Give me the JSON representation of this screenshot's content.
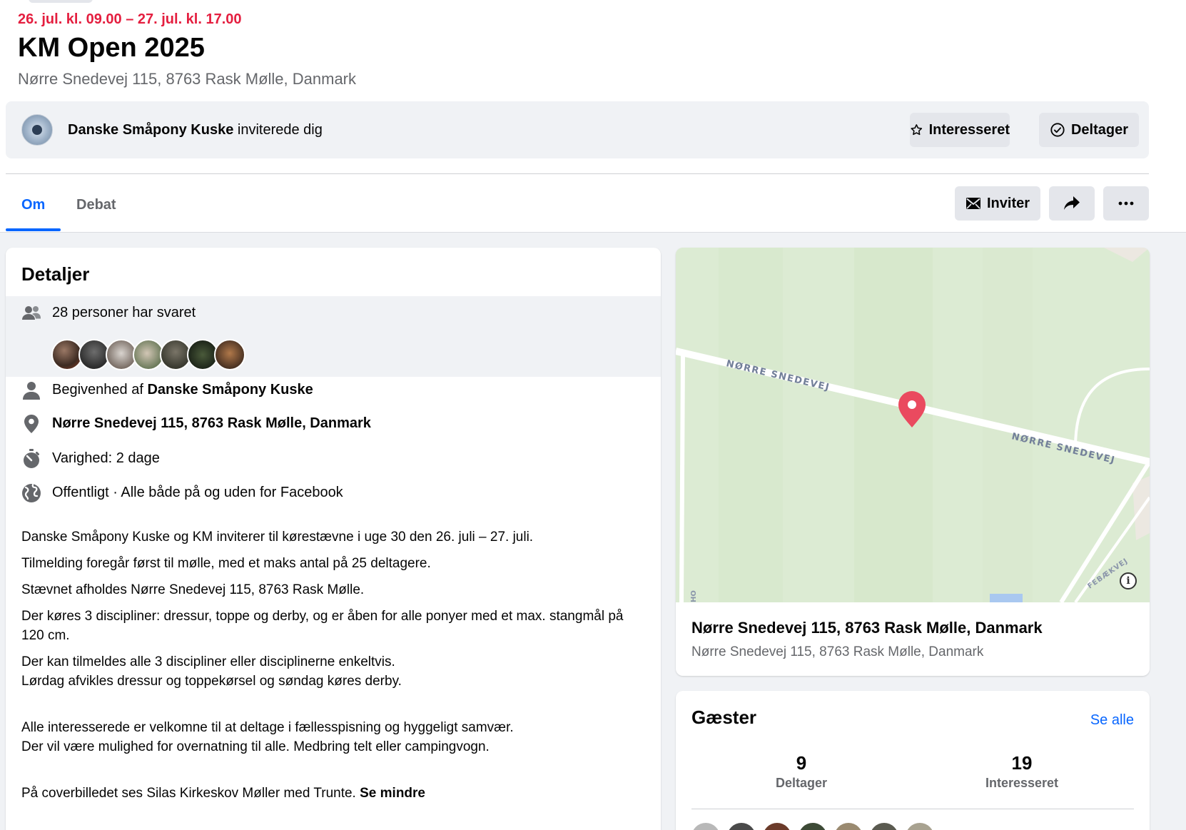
{
  "event": {
    "date": "26. jul. kl. 09.00 – 27. jul. kl. 17.00",
    "title": "KM Open 2025",
    "location": "Nørre Snedevej 115, 8763 Rask Mølle, Danmark"
  },
  "invite": {
    "inviter": "Danske Småpony Kuske",
    "text": " inviterede dig",
    "interested_label": "Interesseret",
    "going_label": "Deltager"
  },
  "tabs": [
    {
      "label": "Om",
      "active": true
    },
    {
      "label": "Debat",
      "active": false
    }
  ],
  "actions": {
    "invite_label": "Inviter"
  },
  "details": {
    "heading": "Detaljer",
    "responded": "28 personer har svaret",
    "organizer_prefix": "Begivenhed af ",
    "organizer": "Danske Småpony Kuske",
    "address": "Nørre Snedevej 115, 8763 Rask Mølle, Danmark",
    "duration": "Varighed: 2 dage",
    "privacy": "Offentligt · Alle både på og uden for Facebook",
    "description": [
      "Danske Småpony Kuske og KM inviterer til kørestævne i uge 30 den 26. juli – 27. juli.",
      "Tilmelding foregår først til mølle, med et maks antal på 25 deltagere.",
      "Stævnet afholdes Nørre Snedevej 115, 8763 Rask Mølle.",
      "Der køres 3 discipliner: dressur, toppe og derby, og er åben for alle ponyer med et max. stangmål på 120 cm.",
      "Der kan tilmeldes alle 3 discipliner eller disciplinerne enkeltvis.",
      "Lørdag afvikles dressur og toppekørsel og søndag køres derby.",
      "Alle interesserede er velkomne til at deltage i fællesspisning og hyggeligt samvær.",
      "Der vil være mulighed for overnatning til alle. Medbring telt eller campingvogn.",
      "På coverbilledet ses Silas Kirkeskov Møller med Trunte. "
    ],
    "see_less": "Se mindre"
  },
  "map": {
    "road_label_1": "NØRRE SNEDEVEJ",
    "road_label_2": "NØRRE SNEDEVEJ",
    "road_label_3": "FEBÆKVEJ",
    "road_label_4": "HO",
    "address_title": "Nørre Snedevej 115, 8763 Rask Mølle, Danmark",
    "address_sub": "Nørre Snedevej 115, 8763 Rask Mølle, Danmark"
  },
  "guests": {
    "heading": "Gæster",
    "see_all": "Se alle",
    "going_count": "9",
    "going_label": "Deltager",
    "interested_count": "19",
    "interested_label": "Interesseret"
  },
  "colors": {
    "accent": "#0866ff",
    "date_red": "#e41e3f",
    "map_green": "#dcebd3",
    "pin": "#ea4a5f"
  }
}
